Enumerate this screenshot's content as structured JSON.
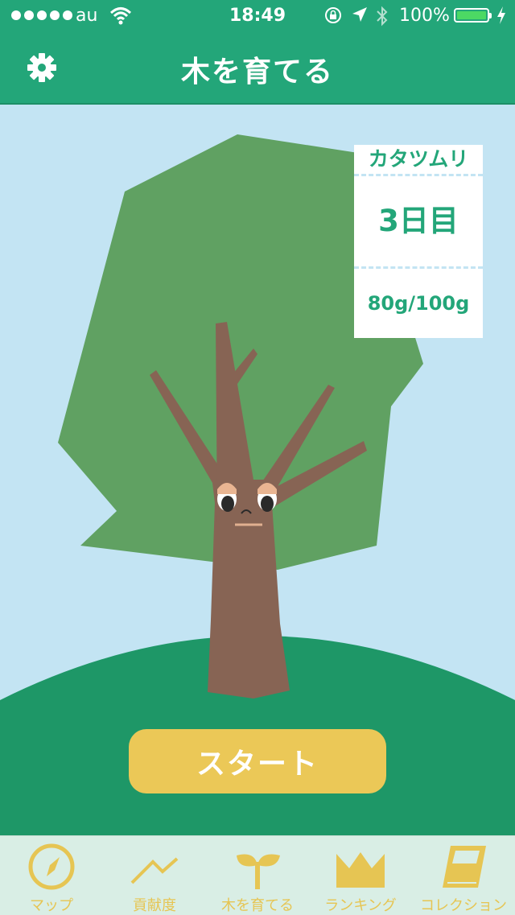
{
  "status_bar": {
    "carrier": "au",
    "time": "18:49",
    "battery_percent": "100%",
    "battery_level": 1.0,
    "battery_color": "#4cd964"
  },
  "nav": {
    "title": "木を育てる",
    "settings_icon": "gear-icon"
  },
  "info_card": {
    "creature": "カタツムリ",
    "day": "3日目",
    "weight": "80g/100g"
  },
  "start_button_label": "スタート",
  "tabs": [
    {
      "label": "マップ",
      "icon": "compass-icon"
    },
    {
      "label": "貢献度",
      "icon": "line-chart-icon"
    },
    {
      "label": "木を育てる",
      "icon": "sprout-icon"
    },
    {
      "label": "ランキング",
      "icon": "crown-icon"
    },
    {
      "label": "コレクション",
      "icon": "book-icon"
    }
  ],
  "colors": {
    "brand_green": "#23a679",
    "sky": "#c3e4f3",
    "hill": "#1e9767",
    "foliage": "#60a162",
    "trunk": "#876454",
    "accent_yellow": "#ebc857",
    "tab_bar_bg": "#d9eee5"
  }
}
